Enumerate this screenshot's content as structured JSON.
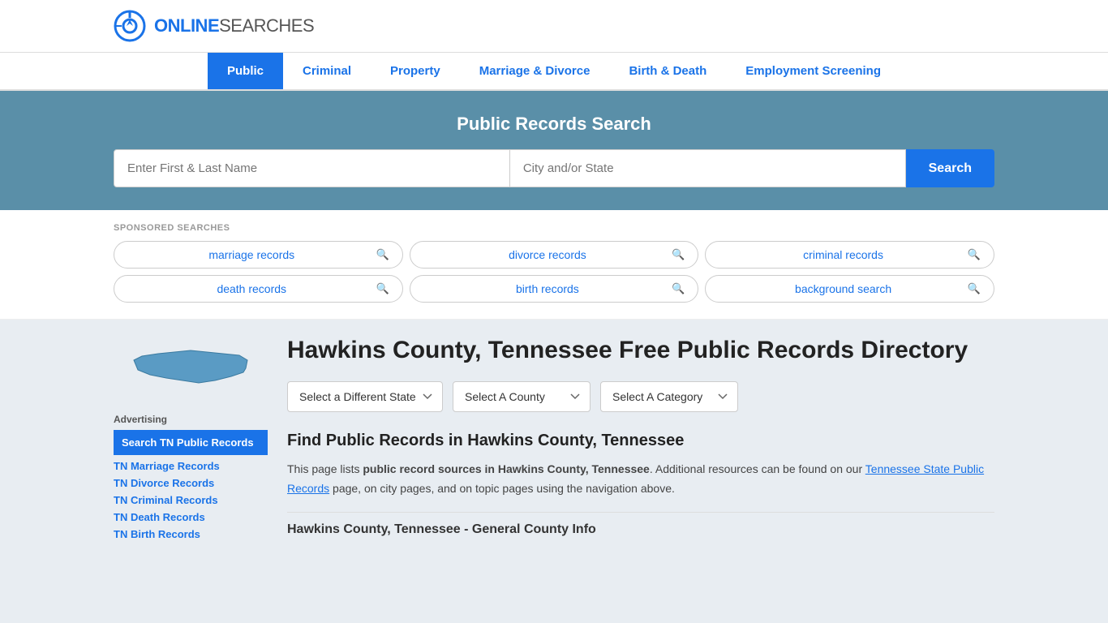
{
  "logo": {
    "online": "ONLINE",
    "searches": "SEARCHES"
  },
  "nav": {
    "items": [
      {
        "label": "Public",
        "active": true
      },
      {
        "label": "Criminal",
        "active": false
      },
      {
        "label": "Property",
        "active": false
      },
      {
        "label": "Marriage & Divorce",
        "active": false
      },
      {
        "label": "Birth & Death",
        "active": false
      },
      {
        "label": "Employment Screening",
        "active": false
      }
    ]
  },
  "hero": {
    "title": "Public Records Search",
    "name_placeholder": "Enter First & Last Name",
    "city_placeholder": "City and/or State",
    "search_button": "Search"
  },
  "sponsored": {
    "label": "SPONSORED SEARCHES",
    "pills": [
      {
        "text": "marriage records"
      },
      {
        "text": "divorce records"
      },
      {
        "text": "criminal records"
      },
      {
        "text": "death records"
      },
      {
        "text": "birth records"
      },
      {
        "text": "background search"
      }
    ]
  },
  "sidebar": {
    "ad_label": "Advertising",
    "ad_highlight": "Search TN Public Records",
    "links": [
      "TN Marriage Records",
      "TN Divorce Records",
      "TN Criminal Records",
      "TN Death Records",
      "TN Birth Records"
    ]
  },
  "article": {
    "title": "Hawkins County, Tennessee Free Public Records Directory",
    "dropdowns": {
      "state": "Select a Different State",
      "county": "Select A County",
      "category": "Select A Category"
    },
    "find_title": "Find Public Records in Hawkins County, Tennessee",
    "find_text_1": "This page lists ",
    "find_text_bold1": "public record sources in Hawkins County, Tennessee",
    "find_text_2": ". Additional resources can be found on our ",
    "find_link": "Tennessee State Public Records",
    "find_text_3": " page, on city pages, and on topic pages using the navigation above.",
    "county_info_title": "Hawkins County, Tennessee - General County Info"
  }
}
